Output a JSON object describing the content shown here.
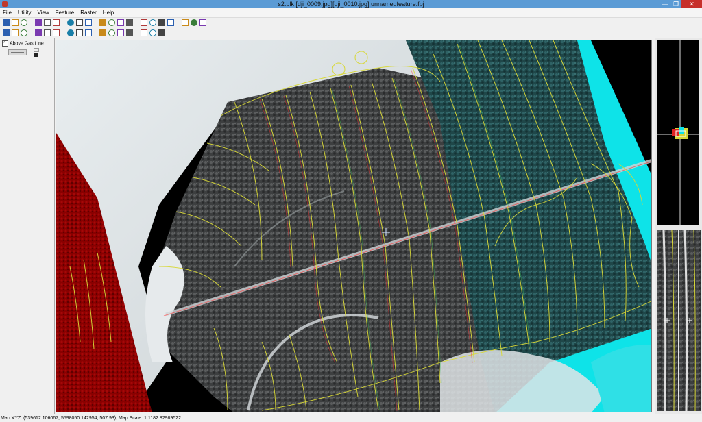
{
  "window": {
    "title": "s2.blk [dji_0009.jpg][dji_0010.jpg]  unnamedfeature.fpj",
    "minimize_glyph": "—",
    "maximize_glyph": "❐",
    "close_glyph": "✕"
  },
  "menu": [
    "File",
    "Utility",
    "View",
    "Feature",
    "Raster",
    "Help"
  ],
  "toolbar_row1_icons": [
    "new-file-icon",
    "open-folder-icon",
    "save-icon",
    "save-all-icon",
    "edit-icon",
    "page-icon",
    "zoom-extents-icon",
    "zoom-fit-icon",
    "target-icon",
    "left-pane-icon",
    "split-view-icon",
    "right-pane-icon",
    "crosshair-icon",
    "layers-icon",
    "measure-icon",
    "globe-icon",
    "info-icon",
    "rotate-icon",
    "window-icon",
    "tile-icon"
  ],
  "toolbar_row2_icons": [
    "select-pointer-icon",
    "select-box-icon",
    "lock-icon",
    "cut-icon",
    "copy-icon",
    "paste-icon",
    "axis-icon",
    "curve-edit-icon",
    "eraser-icon",
    "rectangle-icon",
    "arc-icon",
    "spline-icon",
    "line-icon",
    "cube-icon",
    "box-icon",
    "stack-icon"
  ],
  "left_panel": {
    "checkbox_label": "Above Gas Line",
    "checkbox_checked": true
  },
  "status": {
    "text": "Map XYZ: (539612.106067, 5598050.142954, 507.93), Map Scale: 1:1182.82989522"
  },
  "colors": {
    "title_bar": "#5b9bd5",
    "close_button": "#c7302b",
    "anaglyph_red": "#c40000",
    "anaglyph_cyan": "#00e5ea",
    "contour_line": "#d8d838"
  }
}
